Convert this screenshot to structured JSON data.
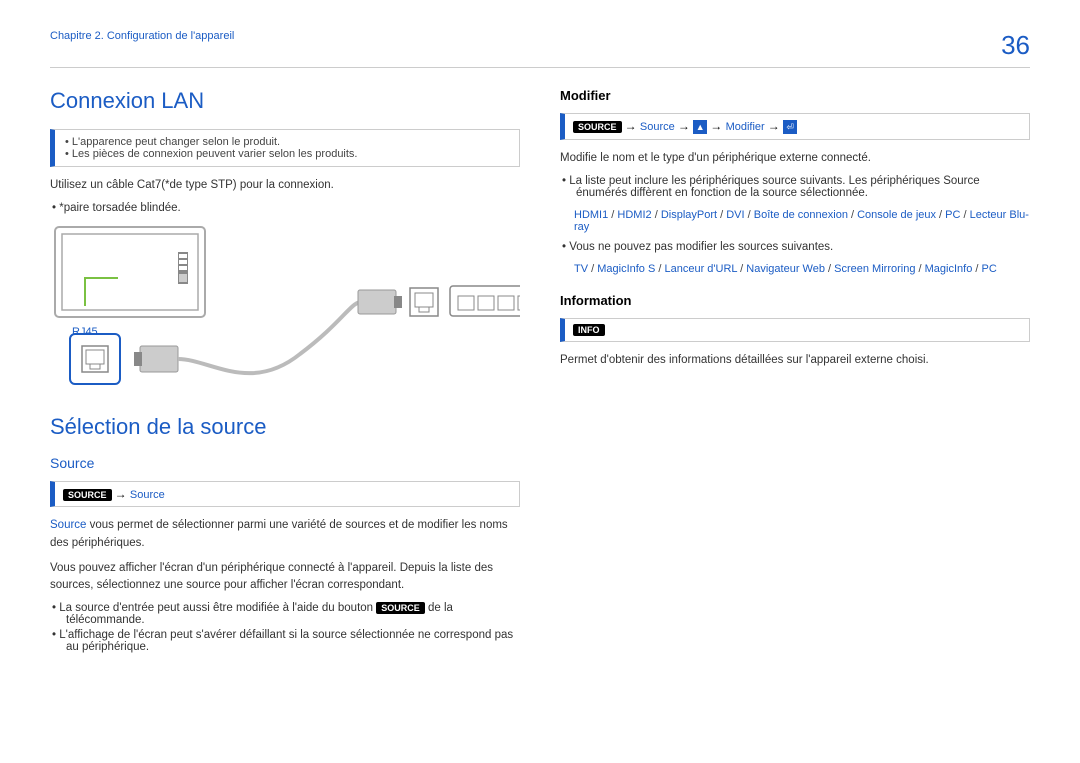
{
  "header": {
    "chapter": "Chapitre 2. Configuration de l'appareil",
    "page": "36"
  },
  "left": {
    "h1_lan": "Connexion LAN",
    "note1_a": "L'apparence peut changer selon le produit.",
    "note1_b": "Les pièces de connexion peuvent varier selon les produits.",
    "p_cable": "Utilisez un câble Cat7(*de type STP) pour la connexion.",
    "li_stp": "*paire torsadée blindée.",
    "rj45": "RJ45",
    "h1_sel": "Sélection de la source",
    "h2_source": "Source",
    "badge_source": "SOURCE",
    "source_link": "Source",
    "p_src1_pre": "Source",
    "p_src1_post": " vous permet de sélectionner parmi une variété de sources et de modifier les noms des périphériques.",
    "p_src2": "Vous pouvez afficher l'écran d'un périphérique connecté à l'appareil. Depuis la liste des sources, sélectionnez une source pour afficher l'écran correspondant.",
    "li_src_a_pre": "La source d'entrée peut aussi être modifiée à l'aide du bouton ",
    "li_src_a_post": " de la télécommande.",
    "li_src_b": "L'affichage de l'écran peut s'avérer défaillant si la source sélectionnée ne correspond pas au périphérique."
  },
  "right": {
    "h3_mod": "Modifier",
    "modifier_link": "Modifier",
    "p_mod": "Modifie le nom et le type d'un périphérique externe connecté.",
    "li_mod_a": "La liste peut inclure les périphériques source suivants. Les périphériques Source énumérés diffèrent en fonction de la source sélectionnée.",
    "opts1": [
      "HDMI1",
      "HDMI2",
      "DisplayPort",
      "DVI",
      "Boîte de connexion",
      "Console de jeux",
      "PC",
      "Lecteur Blu-ray"
    ],
    "li_mod_b": "Vous ne pouvez pas modifier les sources suivantes.",
    "opts2": [
      "TV",
      "MagicInfo S",
      "Lanceur d'URL",
      "Navigateur Web",
      "Screen Mirroring",
      "MagicInfo",
      "PC"
    ],
    "h3_info": "Information",
    "badge_info": "INFO",
    "p_info": "Permet d'obtenir des informations détaillées sur l'appareil externe choisi."
  }
}
